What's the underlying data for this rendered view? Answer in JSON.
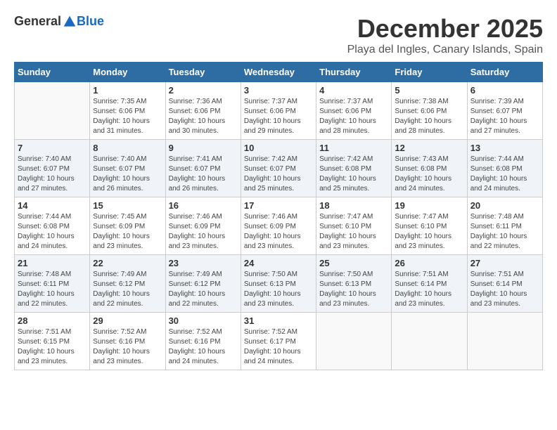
{
  "logo": {
    "general": "General",
    "blue": "Blue"
  },
  "title": {
    "month": "December 2025",
    "location": "Playa del Ingles, Canary Islands, Spain"
  },
  "headers": [
    "Sunday",
    "Monday",
    "Tuesday",
    "Wednesday",
    "Thursday",
    "Friday",
    "Saturday"
  ],
  "weeks": [
    [
      {
        "day": "",
        "info": ""
      },
      {
        "day": "1",
        "info": "Sunrise: 7:35 AM\nSunset: 6:06 PM\nDaylight: 10 hours\nand 31 minutes."
      },
      {
        "day": "2",
        "info": "Sunrise: 7:36 AM\nSunset: 6:06 PM\nDaylight: 10 hours\nand 30 minutes."
      },
      {
        "day": "3",
        "info": "Sunrise: 7:37 AM\nSunset: 6:06 PM\nDaylight: 10 hours\nand 29 minutes."
      },
      {
        "day": "4",
        "info": "Sunrise: 7:37 AM\nSunset: 6:06 PM\nDaylight: 10 hours\nand 28 minutes."
      },
      {
        "day": "5",
        "info": "Sunrise: 7:38 AM\nSunset: 6:06 PM\nDaylight: 10 hours\nand 28 minutes."
      },
      {
        "day": "6",
        "info": "Sunrise: 7:39 AM\nSunset: 6:07 PM\nDaylight: 10 hours\nand 27 minutes."
      }
    ],
    [
      {
        "day": "7",
        "info": "Sunrise: 7:40 AM\nSunset: 6:07 PM\nDaylight: 10 hours\nand 27 minutes."
      },
      {
        "day": "8",
        "info": "Sunrise: 7:40 AM\nSunset: 6:07 PM\nDaylight: 10 hours\nand 26 minutes."
      },
      {
        "day": "9",
        "info": "Sunrise: 7:41 AM\nSunset: 6:07 PM\nDaylight: 10 hours\nand 26 minutes."
      },
      {
        "day": "10",
        "info": "Sunrise: 7:42 AM\nSunset: 6:07 PM\nDaylight: 10 hours\nand 25 minutes."
      },
      {
        "day": "11",
        "info": "Sunrise: 7:42 AM\nSunset: 6:08 PM\nDaylight: 10 hours\nand 25 minutes."
      },
      {
        "day": "12",
        "info": "Sunrise: 7:43 AM\nSunset: 6:08 PM\nDaylight: 10 hours\nand 24 minutes."
      },
      {
        "day": "13",
        "info": "Sunrise: 7:44 AM\nSunset: 6:08 PM\nDaylight: 10 hours\nand 24 minutes."
      }
    ],
    [
      {
        "day": "14",
        "info": "Sunrise: 7:44 AM\nSunset: 6:08 PM\nDaylight: 10 hours\nand 24 minutes."
      },
      {
        "day": "15",
        "info": "Sunrise: 7:45 AM\nSunset: 6:09 PM\nDaylight: 10 hours\nand 23 minutes."
      },
      {
        "day": "16",
        "info": "Sunrise: 7:46 AM\nSunset: 6:09 PM\nDaylight: 10 hours\nand 23 minutes."
      },
      {
        "day": "17",
        "info": "Sunrise: 7:46 AM\nSunset: 6:09 PM\nDaylight: 10 hours\nand 23 minutes."
      },
      {
        "day": "18",
        "info": "Sunrise: 7:47 AM\nSunset: 6:10 PM\nDaylight: 10 hours\nand 23 minutes."
      },
      {
        "day": "19",
        "info": "Sunrise: 7:47 AM\nSunset: 6:10 PM\nDaylight: 10 hours\nand 23 minutes."
      },
      {
        "day": "20",
        "info": "Sunrise: 7:48 AM\nSunset: 6:11 PM\nDaylight: 10 hours\nand 22 minutes."
      }
    ],
    [
      {
        "day": "21",
        "info": "Sunrise: 7:48 AM\nSunset: 6:11 PM\nDaylight: 10 hours\nand 22 minutes."
      },
      {
        "day": "22",
        "info": "Sunrise: 7:49 AM\nSunset: 6:12 PM\nDaylight: 10 hours\nand 22 minutes."
      },
      {
        "day": "23",
        "info": "Sunrise: 7:49 AM\nSunset: 6:12 PM\nDaylight: 10 hours\nand 22 minutes."
      },
      {
        "day": "24",
        "info": "Sunrise: 7:50 AM\nSunset: 6:13 PM\nDaylight: 10 hours\nand 23 minutes."
      },
      {
        "day": "25",
        "info": "Sunrise: 7:50 AM\nSunset: 6:13 PM\nDaylight: 10 hours\nand 23 minutes."
      },
      {
        "day": "26",
        "info": "Sunrise: 7:51 AM\nSunset: 6:14 PM\nDaylight: 10 hours\nand 23 minutes."
      },
      {
        "day": "27",
        "info": "Sunrise: 7:51 AM\nSunset: 6:14 PM\nDaylight: 10 hours\nand 23 minutes."
      }
    ],
    [
      {
        "day": "28",
        "info": "Sunrise: 7:51 AM\nSunset: 6:15 PM\nDaylight: 10 hours\nand 23 minutes."
      },
      {
        "day": "29",
        "info": "Sunrise: 7:52 AM\nSunset: 6:16 PM\nDaylight: 10 hours\nand 23 minutes."
      },
      {
        "day": "30",
        "info": "Sunrise: 7:52 AM\nSunset: 6:16 PM\nDaylight: 10 hours\nand 24 minutes."
      },
      {
        "day": "31",
        "info": "Sunrise: 7:52 AM\nSunset: 6:17 PM\nDaylight: 10 hours\nand 24 minutes."
      },
      {
        "day": "",
        "info": ""
      },
      {
        "day": "",
        "info": ""
      },
      {
        "day": "",
        "info": ""
      }
    ]
  ]
}
